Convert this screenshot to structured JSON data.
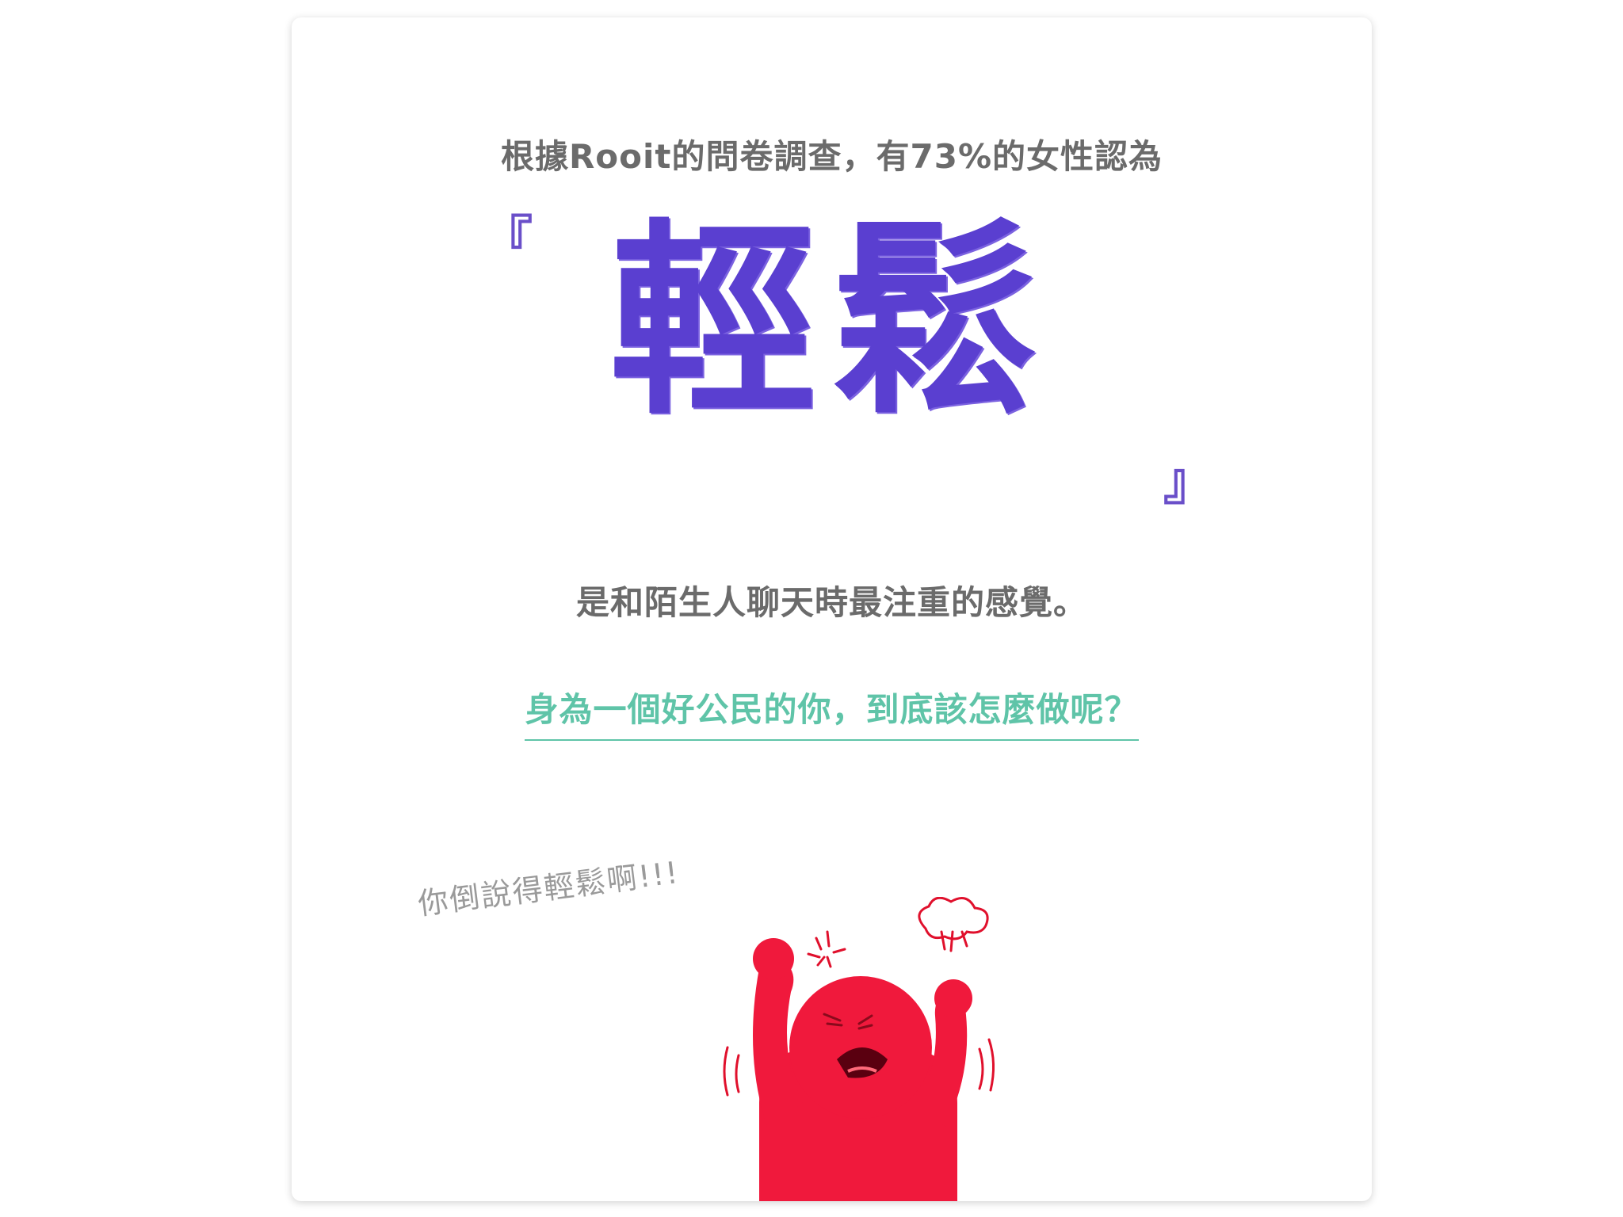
{
  "intro_text": "根據Rooit的問卷調查，有73%的女性認為",
  "quote_open": "『",
  "quote_close": "』",
  "big_word": "輕鬆",
  "sub_text": "是和陌生人聊天時最注重的感覺。",
  "question_link": "身為一個好公民的你，到底該怎麼做呢？",
  "illustration": {
    "caption": "你倒說得輕鬆啊!!!",
    "icon": "angry-red-character-icon"
  },
  "colors": {
    "accent_purple": "#5a3fd0",
    "accent_green": "#5fc4a8",
    "text_gray": "#6b6b6b",
    "character_red": "#f0193c"
  }
}
